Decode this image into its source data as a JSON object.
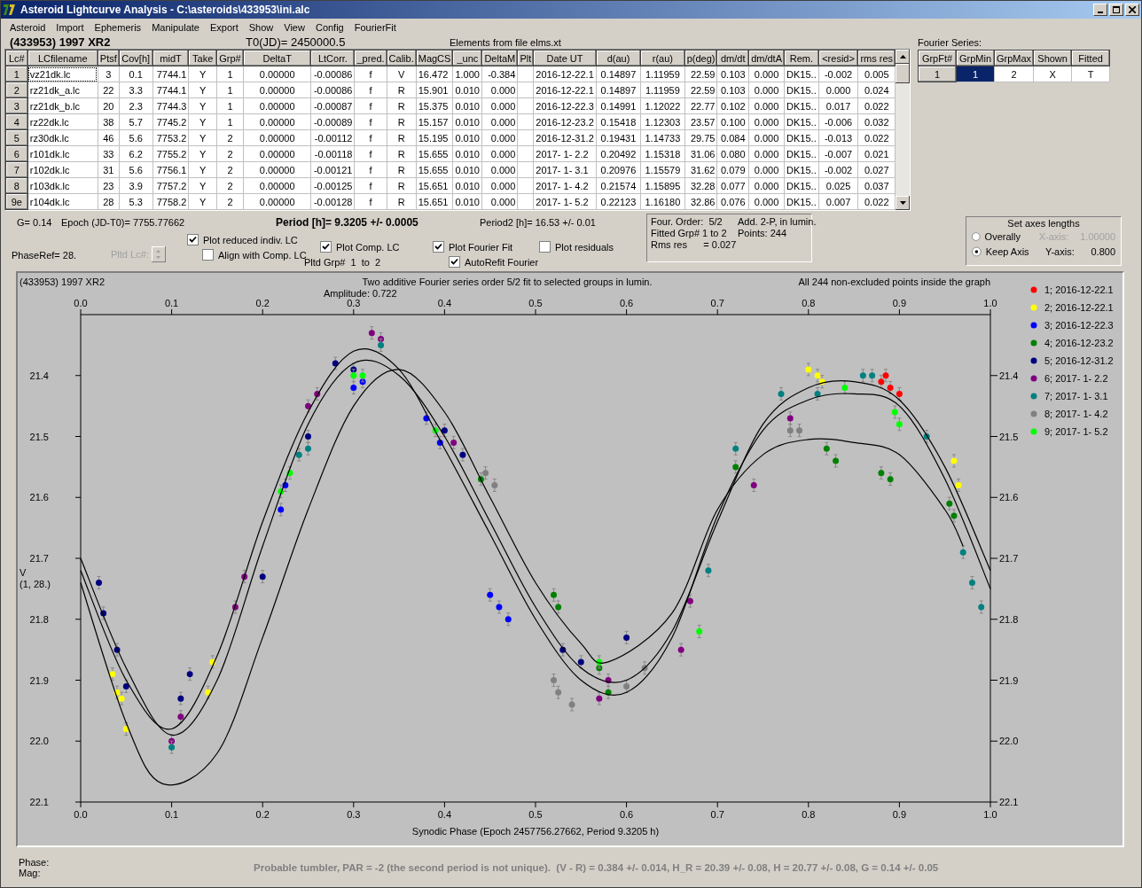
{
  "window": {
    "title": "Asteroid Lightcurve Analysis - C:\\asteroids\\433953\\ini.alc",
    "menu": [
      "Asteroid",
      "Import",
      "Ephemeris",
      "Manipulate",
      "Export",
      "Show",
      "View",
      "Config",
      "FourierFit"
    ]
  },
  "header": {
    "object": "(433953) 1997 XR2",
    "t0": "T0(JD)= 2450000.5",
    "elements": "Elements from file elms.xt"
  },
  "table": {
    "columns": [
      "Lc#",
      "LCfilename",
      "Ptsf",
      "Cov[h]",
      "midT",
      "Take",
      "Grp#",
      "DeltaT",
      "LtCorr.",
      "_pred.",
      "Calib.",
      "MagCS",
      "_unc",
      "DeltaM",
      "Plt",
      "Date UT",
      "d(au)",
      "r(au)",
      "p(deg)",
      "dm/dt",
      "dm/dtA",
      "Rem.",
      "<resid>",
      "rms res"
    ],
    "rows": [
      {
        "focused": true,
        "cells": [
          "1",
          "vz21dk.lc",
          "3",
          "0.1",
          "7744.1",
          "Y",
          "1",
          "0.00000",
          "-0.00086",
          "f",
          "V",
          "16.472",
          "1.000",
          "-0.384",
          "",
          "2016-12-22.1",
          "0.14897",
          "1.11959",
          "22.59",
          "0.103",
          "0.000",
          "DK15..",
          "-0.002",
          "0.005"
        ]
      },
      {
        "focused": false,
        "cells": [
          "2",
          "rz21dk_a.lc",
          "22",
          "3.3",
          "7744.1",
          "Y",
          "1",
          "0.00000",
          "-0.00086",
          "f",
          "R",
          "15.901",
          "0.010",
          "0.000",
          "",
          "2016-12-22.1",
          "0.14897",
          "1.11959",
          "22.59",
          "0.103",
          "0.000",
          "DK15..",
          "0.000",
          "0.024"
        ]
      },
      {
        "focused": false,
        "cells": [
          "3",
          "rz21dk_b.lc",
          "20",
          "2.3",
          "7744.3",
          "Y",
          "1",
          "0.00000",
          "-0.00087",
          "f",
          "R",
          "15.375",
          "0.010",
          "0.000",
          "",
          "2016-12-22.3",
          "0.14991",
          "1.12022",
          "22.77",
          "0.102",
          "0.000",
          "DK15..",
          "0.017",
          "0.022"
        ]
      },
      {
        "focused": false,
        "cells": [
          "4",
          "rz22dk.lc",
          "38",
          "5.7",
          "7745.2",
          "Y",
          "1",
          "0.00000",
          "-0.00089",
          "f",
          "R",
          "15.157",
          "0.010",
          "0.000",
          "",
          "2016-12-23.2",
          "0.15418",
          "1.12303",
          "23.57",
          "0.100",
          "0.000",
          "DK15..",
          "-0.006",
          "0.032"
        ]
      },
      {
        "focused": false,
        "cells": [
          "5",
          "rz30dk.lc",
          "46",
          "5.6",
          "7753.2",
          "Y",
          "2",
          "0.00000",
          "-0.00112",
          "f",
          "R",
          "15.195",
          "0.010",
          "0.000",
          "",
          "2016-12-31.2",
          "0.19431",
          "1.14733",
          "29.75",
          "0.084",
          "0.000",
          "DK15..",
          "-0.013",
          "0.022"
        ]
      },
      {
        "focused": false,
        "cells": [
          "6",
          "r101dk.lc",
          "33",
          "6.2",
          "7755.2",
          "Y",
          "2",
          "0.00000",
          "-0.00118",
          "f",
          "R",
          "15.655",
          "0.010",
          "0.000",
          "",
          "2017- 1- 2.2",
          "0.20492",
          "1.15318",
          "31.06",
          "0.080",
          "0.000",
          "DK15..",
          "-0.007",
          "0.021"
        ]
      },
      {
        "focused": false,
        "cells": [
          "7",
          "r102dk.lc",
          "31",
          "5.6",
          "7756.1",
          "Y",
          "2",
          "0.00000",
          "-0.00121",
          "f",
          "R",
          "15.655",
          "0.010",
          "0.000",
          "",
          "2017- 1- 3.1",
          "0.20976",
          "1.15579",
          "31.62",
          "0.079",
          "0.000",
          "DK15..",
          "-0.002",
          "0.027"
        ]
      },
      {
        "focused": false,
        "cells": [
          "8",
          "r103dk.lc",
          "23",
          "3.9",
          "7757.2",
          "Y",
          "2",
          "0.00000",
          "-0.00125",
          "f",
          "R",
          "15.651",
          "0.010",
          "0.000",
          "",
          "2017- 1- 4.2",
          "0.21574",
          "1.15895",
          "32.28",
          "0.077",
          "0.000",
          "DK15..",
          "0.025",
          "0.037"
        ]
      },
      {
        "focused": false,
        "cells": [
          "9e",
          "r104dk.lc",
          "28",
          "5.3",
          "7758.2",
          "Y",
          "2",
          "0.00000",
          "-0.00128",
          "f",
          "R",
          "15.651",
          "0.010",
          "0.000",
          "",
          "2017- 1- 5.2",
          "0.22123",
          "1.16180",
          "32.86",
          "0.076",
          "0.000",
          "DK15..",
          "0.007",
          "0.022"
        ]
      }
    ]
  },
  "fourier": {
    "label": "Fourier Series:",
    "columns": [
      "GrpFt#",
      "GrpMin",
      "GrpMax",
      "Shown",
      "Fitted"
    ],
    "rows": [
      {
        "cells": [
          {
            "text": "1",
            "selected": false
          },
          {
            "text": "1",
            "selected": true
          },
          {
            "text": "2",
            "selected": false
          },
          {
            "text": "X",
            "selected": false
          },
          {
            "text": "T",
            "selected": false
          }
        ]
      }
    ]
  },
  "info": {
    "g": "G= 0.14",
    "epoch": "Epoch (JD-T0)= 7755.77662",
    "period": "Period [h]= 9.3205 +/- 0.0005",
    "period2": "Period2 [h]= 16.53 +/- 0.01",
    "phaseref": "PhaseRef= 28.",
    "pltd_lc": {
      "label": "Pltd Lc#:",
      "disabled": true
    },
    "columns": [
      {
        "items": [
          {
            "kind": "checkbox",
            "label": "Plot reduced indiv. LC",
            "checked": true
          },
          {
            "kind": "checkbox",
            "label": "Align with Comp. LC",
            "checked": false
          }
        ]
      },
      {
        "items": [
          {
            "kind": "checkbox",
            "label": "Plot Comp. LC",
            "checked": true
          },
          {
            "kind": "text",
            "text": "Pltd Grp#  1  to  2"
          }
        ]
      },
      {
        "items": [
          {
            "kind": "checkbox",
            "label": "Plot Fourier Fit",
            "checked": true
          },
          {
            "kind": "checkbox",
            "label": "AutoRefit Fourier",
            "checked": true
          }
        ]
      },
      {
        "items": [
          {
            "kind": "checkbox",
            "label": "Plot residuals",
            "checked": false
          }
        ]
      }
    ]
  },
  "fit_box": {
    "lines": [
      "Four. Order:  5/2",
      "Add. 2-P, in lumin.",
      "Fitted Grp# 1 to 2",
      "Points: 244",
      "Rms res      = 0.027"
    ]
  },
  "axes_box": {
    "title": "Set axes lengths",
    "options": [
      {
        "label": "Overally",
        "selected": false
      },
      {
        "label": "Keep Axis",
        "selected": true
      }
    ],
    "fields": [
      {
        "label": "X-axis:",
        "value": "1.00000",
        "disabled": true
      },
      {
        "label": "Y-axis:",
        "value": "0.800",
        "disabled": false
      }
    ]
  },
  "chart": {
    "chart_data": {
      "type": "scatter",
      "title": "Two additive Fourier series order 5/2 fit to selected groups in lumin.",
      "xlabel": "Synodic Phase (Epoch 2457756.27662, Period 9.3205 h)",
      "ylabel": "V",
      "xlim": [
        0,
        1
      ],
      "ylim": [
        22.1,
        21.3
      ],
      "xticks": [
        {
          "value": 0,
          "label": "0.0"
        },
        {
          "value": 0.1,
          "label": "0.1"
        },
        {
          "value": 0.2,
          "label": "0.2"
        },
        {
          "value": 0.3,
          "label": "0.3"
        },
        {
          "value": 0.4,
          "label": "0.4"
        },
        {
          "value": 0.5,
          "label": "0.5"
        },
        {
          "value": 0.6,
          "label": "0.6"
        },
        {
          "value": 0.7,
          "label": "0.7"
        },
        {
          "value": 0.8,
          "label": "0.8"
        },
        {
          "value": 0.9,
          "label": "0.9"
        },
        {
          "value": 1,
          "label": "1.0"
        }
      ],
      "yticks": [
        {
          "value": 21.4,
          "label": "21.4"
        },
        {
          "value": 21.5,
          "label": "21.5"
        },
        {
          "value": 21.6,
          "label": "21.6"
        },
        {
          "value": 21.7,
          "label": "21.7"
        },
        {
          "value": 21.8,
          "label": "21.8"
        },
        {
          "value": 21.9,
          "label": "21.9"
        },
        {
          "value": 22,
          "label": "22.0"
        },
        {
          "value": 22.1,
          "label": "22.1"
        }
      ],
      "legend": "right",
      "annotations": [
        "(433953) 1997 XR2",
        "Amplitude: 0.722",
        "All 244 non-excluded points inside the graph",
        "(1, 28.)"
      ],
      "series": [
        {
          "name": "1; 2016-12-22.1",
          "color": "#ff0000",
          "x": [
            0.88,
            0.885,
            0.89,
            0.9
          ],
          "values": [
            21.41,
            21.4,
            21.42,
            21.43
          ]
        },
        {
          "name": "2; 2016-12-22.1",
          "color": "#ffff00",
          "x": [
            0.035,
            0.04,
            0.045,
            0.05,
            0.14,
            0.145,
            0.8,
            0.81,
            0.815,
            0.96,
            0.965
          ],
          "values": [
            21.89,
            21.92,
            21.93,
            21.98,
            21.92,
            21.87,
            21.39,
            21.4,
            21.41,
            21.54,
            21.58
          ]
        },
        {
          "name": "3; 2016-12-22.3",
          "color": "#0000ff",
          "x": [
            0.22,
            0.225,
            0.3,
            0.31,
            0.38,
            0.395,
            0.45,
            0.46,
            0.47
          ],
          "values": [
            21.62,
            21.58,
            21.42,
            21.41,
            21.47,
            21.51,
            21.76,
            21.78,
            21.8
          ]
        },
        {
          "name": "4; 2016-12-23.2",
          "color": "#008000",
          "x": [
            0.44,
            0.52,
            0.525,
            0.57,
            0.58,
            0.72,
            0.82,
            0.83,
            0.88,
            0.89,
            0.955,
            0.96
          ],
          "values": [
            21.57,
            21.76,
            21.78,
            21.88,
            21.92,
            21.55,
            21.52,
            21.54,
            21.56,
            21.57,
            21.61,
            21.63
          ]
        },
        {
          "name": "5; 2016-12-31.2",
          "color": "#000080",
          "x": [
            0.02,
            0.025,
            0.04,
            0.05,
            0.11,
            0.12,
            0.2,
            0.25,
            0.28,
            0.3,
            0.4,
            0.42,
            0.53,
            0.55,
            0.6
          ],
          "values": [
            21.74,
            21.79,
            21.85,
            21.91,
            21.93,
            21.89,
            21.73,
            21.5,
            21.38,
            21.39,
            21.49,
            21.53,
            21.85,
            21.87,
            21.83
          ]
        },
        {
          "name": "6; 2017- 1- 2.2",
          "color": "#800080",
          "x": [
            0.1,
            0.11,
            0.17,
            0.18,
            0.25,
            0.26,
            0.32,
            0.33,
            0.41,
            0.57,
            0.58,
            0.66,
            0.67,
            0.74,
            0.78
          ],
          "values": [
            22.0,
            21.96,
            21.78,
            21.73,
            21.45,
            21.43,
            21.33,
            21.34,
            21.51,
            21.93,
            21.9,
            21.85,
            21.77,
            21.58,
            21.47
          ]
        },
        {
          "name": "7; 2017- 1- 3.1",
          "color": "#008080",
          "x": [
            0.1,
            0.24,
            0.25,
            0.33,
            0.69,
            0.72,
            0.77,
            0.81,
            0.86,
            0.87,
            0.93,
            0.97,
            0.98,
            0.99
          ],
          "values": [
            22.01,
            21.53,
            21.52,
            21.35,
            21.72,
            21.52,
            21.43,
            21.43,
            21.4,
            21.4,
            21.5,
            21.69,
            21.74,
            21.78
          ]
        },
        {
          "name": "8; 2017- 1- 4.2",
          "color": "#808080",
          "x": [
            0.445,
            0.455,
            0.52,
            0.525,
            0.54,
            0.6,
            0.62,
            0.78,
            0.79
          ],
          "values": [
            21.56,
            21.58,
            21.9,
            21.92,
            21.94,
            21.91,
            21.88,
            21.49,
            21.49
          ]
        },
        {
          "name": "9; 2017- 1- 5.2",
          "color": "#00ff00",
          "x": [
            0.22,
            0.23,
            0.3,
            0.31,
            0.39,
            0.57,
            0.68,
            0.84,
            0.895,
            0.9
          ],
          "values": [
            21.59,
            21.56,
            21.4,
            21.4,
            21.49,
            21.87,
            21.82,
            21.42,
            21.46,
            21.48
          ]
        },
        {
          "type": "line",
          "color": "#000000",
          "x": [
            0,
            0.05,
            0.1,
            0.15,
            0.2,
            0.25,
            0.3,
            0.35,
            0.4,
            0.45,
            0.5,
            0.55,
            0.6,
            0.65,
            0.7,
            0.75,
            0.8,
            0.85,
            0.9,
            0.95,
            1
          ],
          "values": [
            21.7,
            21.88,
            21.99,
            21.9,
            21.68,
            21.48,
            21.38,
            21.4,
            21.5,
            21.64,
            21.78,
            21.88,
            21.9,
            21.82,
            21.64,
            21.48,
            21.42,
            21.41,
            21.44,
            21.55,
            21.72
          ]
        },
        {
          "type": "line",
          "color": "#000000",
          "x": [
            0,
            0.05,
            0.1,
            0.15,
            0.2,
            0.25,
            0.3,
            0.35,
            0.4,
            0.45,
            0.5,
            0.55,
            0.6,
            0.65,
            0.7,
            0.75,
            0.8,
            0.85,
            0.9,
            0.95,
            1
          ],
          "values": [
            21.72,
            21.9,
            21.98,
            21.86,
            21.64,
            21.46,
            21.36,
            21.39,
            21.52,
            21.66,
            21.8,
            21.9,
            21.92,
            21.83,
            21.63,
            21.49,
            21.44,
            21.43,
            21.45,
            21.57,
            21.75
          ]
        },
        {
          "type": "line",
          "color": "#000000",
          "x": [
            0,
            0.05,
            0.09,
            0.15,
            0.2,
            0.25,
            0.3,
            0.35,
            0.4,
            0.45,
            0.5,
            0.55,
            0.58,
            0.65,
            0.7,
            0.75,
            0.8,
            0.85,
            0.9,
            0.95,
            0.97
          ],
          "values": [
            21.74,
            21.97,
            22.07,
            22.02,
            21.83,
            21.62,
            21.45,
            21.39,
            21.46,
            21.6,
            21.74,
            21.84,
            21.87,
            21.79,
            21.62,
            21.53,
            21.505,
            21.51,
            21.53,
            21.62,
            21.68
          ]
        }
      ]
    }
  },
  "footer": {
    "phase_label": "Phase:",
    "mag_label": "Mag:",
    "status": "Probable tumbler, PAR = -2 (the second period is not unique).  (V - R) = 0.384 +/- 0.014, H_R = 20.39 +/- 0.08, H = 20.77 +/- 0.08, G = 0.14 +/- 0.05"
  }
}
